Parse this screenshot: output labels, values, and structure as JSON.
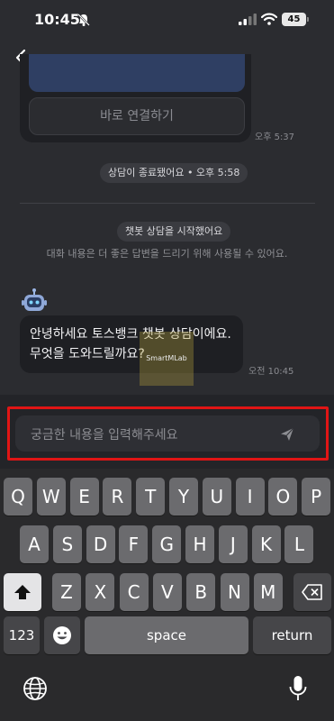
{
  "status_bar": {
    "time": "10:45",
    "battery": "45"
  },
  "chat": {
    "connect_button_label": "바로 연결하기",
    "message_time_1": "오후 5:37",
    "consult_ended": "상담이 종료됐어요 • 오후 5:58",
    "chatbot_started": "챗봇 상담을 시작했어요",
    "notice": "대화 내용은 더 좋은 답변을 드리기 위해 사용될 수 있어요.",
    "bot_message_line1": "안녕하세요 토스뱅크 챗봇 상담이에요.",
    "bot_message_line2": "무엇을 도와드릴까요?",
    "message_time_2": "오전 10:45"
  },
  "watermark": "SmartMLab",
  "input": {
    "placeholder": "궁금한 내용을 입력해주세요"
  },
  "keyboard": {
    "row1": [
      "Q",
      "W",
      "E",
      "R",
      "T",
      "Y",
      "U",
      "I",
      "O",
      "P"
    ],
    "row2": [
      "A",
      "S",
      "D",
      "F",
      "G",
      "H",
      "J",
      "K",
      "L"
    ],
    "row3": [
      "Z",
      "X",
      "C",
      "V",
      "B",
      "N",
      "M"
    ],
    "numbers_key": "123",
    "space_key": "space",
    "return_key": "return"
  },
  "colors": {
    "background": "#2b2c30",
    "highlight": "#e01515",
    "bubble": "#1e1f23"
  },
  "icons": [
    "back-chevron-icon",
    "bell-slash-icon",
    "signal-icon",
    "wifi-icon",
    "robot-icon",
    "send-icon",
    "shift-icon",
    "backspace-icon",
    "emoji-icon",
    "globe-icon",
    "mic-icon"
  ]
}
